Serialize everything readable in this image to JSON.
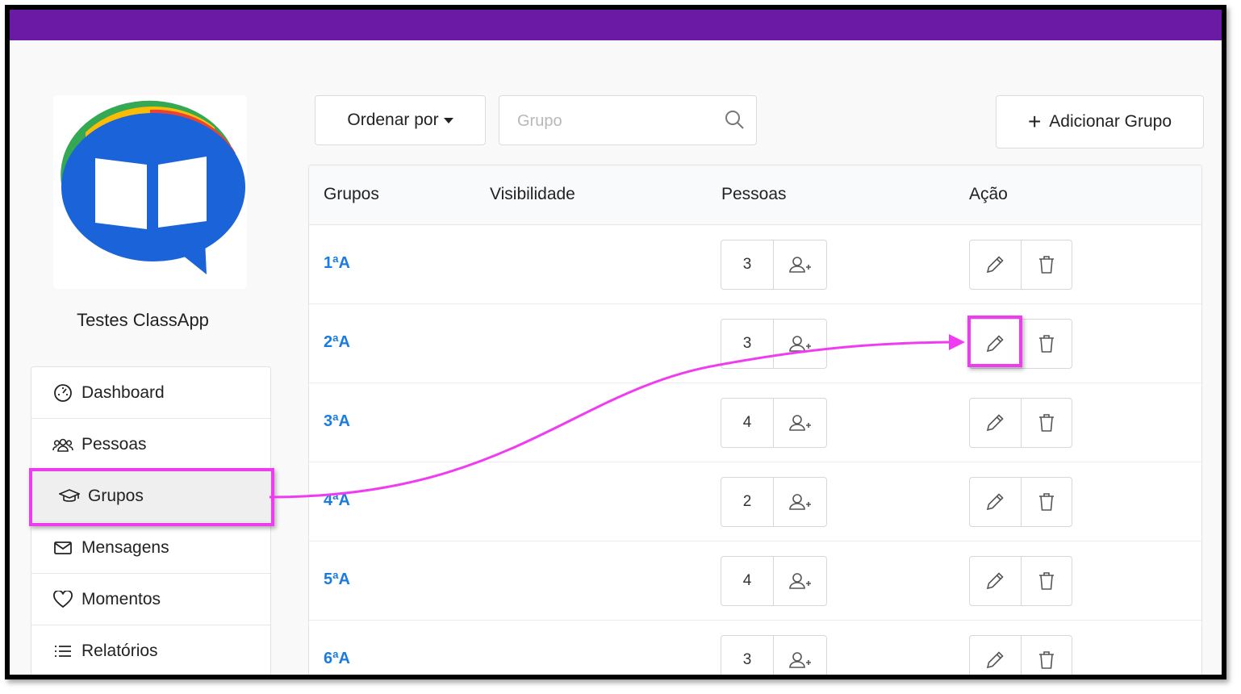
{
  "brand": {
    "topbar_color": "#6b1aa6",
    "link_color": "#1a7be0",
    "annotation_color": "#f03cf0"
  },
  "sidebar": {
    "org_name": "Testes ClassApp",
    "items": [
      {
        "label": "Dashboard",
        "icon": "dashboard-gauge-icon"
      },
      {
        "label": "Pessoas",
        "icon": "people-icon"
      },
      {
        "label": "Grupos",
        "icon": "graduation-cap-icon",
        "active": true
      },
      {
        "label": "Mensagens",
        "icon": "envelope-icon"
      },
      {
        "label": "Momentos",
        "icon": "heart-icon"
      },
      {
        "label": "Relatórios",
        "icon": "list-icon"
      }
    ]
  },
  "toolbar": {
    "sort_label": "Ordenar por",
    "search_placeholder": "Grupo",
    "add_label": "Adicionar Grupo"
  },
  "table": {
    "headers": {
      "groups": "Grupos",
      "visibility": "Visibilidade",
      "people": "Pessoas",
      "action": "Ação"
    },
    "rows": [
      {
        "name": "1ªA",
        "people": "3"
      },
      {
        "name": "2ªA",
        "people": "3"
      },
      {
        "name": "3ªA",
        "people": "4"
      },
      {
        "name": "4ªA",
        "people": "2"
      },
      {
        "name": "5ªA",
        "people": "4"
      },
      {
        "name": "6ªA",
        "people": "3"
      }
    ]
  }
}
